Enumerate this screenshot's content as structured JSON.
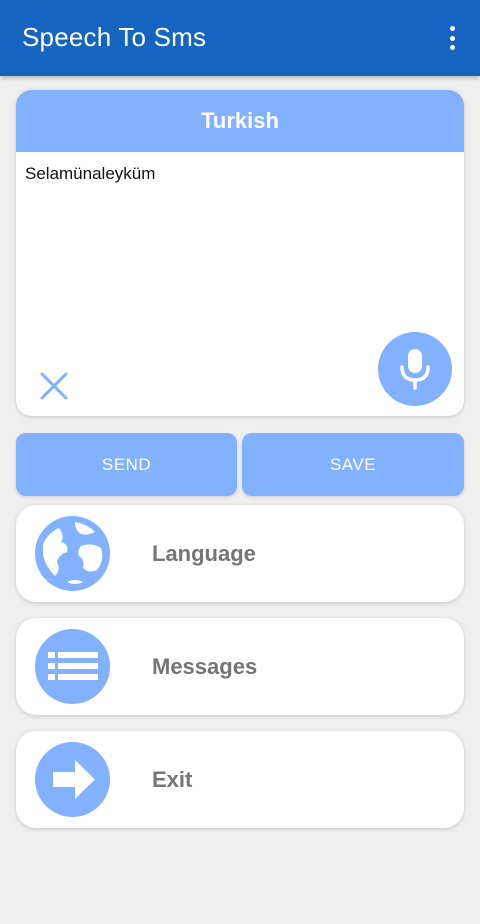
{
  "appbar": {
    "title": "Speech To Sms",
    "menu_icon": "more-vert-icon"
  },
  "speech_card": {
    "language_label": "Turkish",
    "text": "Selamünaleyküm",
    "clear_icon": "close-icon",
    "mic_icon": "microphone-icon"
  },
  "actions": {
    "send_label": "SEND",
    "save_label": "SAVE"
  },
  "menu": {
    "language": {
      "label": "Language",
      "icon": "globe-icon"
    },
    "messages": {
      "label": "Messages",
      "icon": "list-icon"
    },
    "exit": {
      "label": "Exit",
      "icon": "arrow-right-icon"
    }
  },
  "colors": {
    "appbar": "#1565c0",
    "accent": "#82b1ff",
    "background": "#efefef",
    "menu_text": "#757575"
  }
}
